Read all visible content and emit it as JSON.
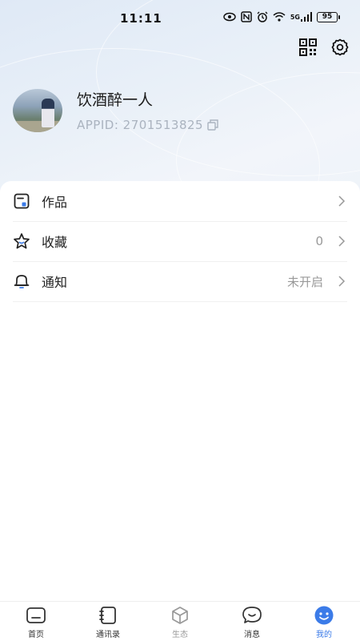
{
  "status_bar": {
    "time": "11:11",
    "network_label": "5G",
    "battery": "95"
  },
  "header": {
    "qr_icon": "qr-code-icon",
    "settings_icon": "gear-icon"
  },
  "profile": {
    "nickname": "饮酒醉一人",
    "appid": "APPID: 2701513825",
    "copy_icon": "copy-icon"
  },
  "menu": [
    {
      "label": "作品",
      "value": "",
      "icon": "works-icon"
    },
    {
      "label": "收藏",
      "value": "0",
      "icon": "star-icon"
    },
    {
      "label": "通知",
      "value": "未开启",
      "icon": "bell-icon"
    }
  ],
  "tabs": [
    {
      "label": "首页",
      "icon": "home-icon"
    },
    {
      "label": "通讯录",
      "icon": "contacts-icon"
    },
    {
      "label": "生态",
      "icon": "cube-icon"
    },
    {
      "label": "消息",
      "icon": "chat-icon"
    },
    {
      "label": "我的",
      "icon": "smiley-icon",
      "active": true
    }
  ],
  "colors": {
    "accent": "#3b7be8",
    "header_bg": "#e6eef8"
  }
}
